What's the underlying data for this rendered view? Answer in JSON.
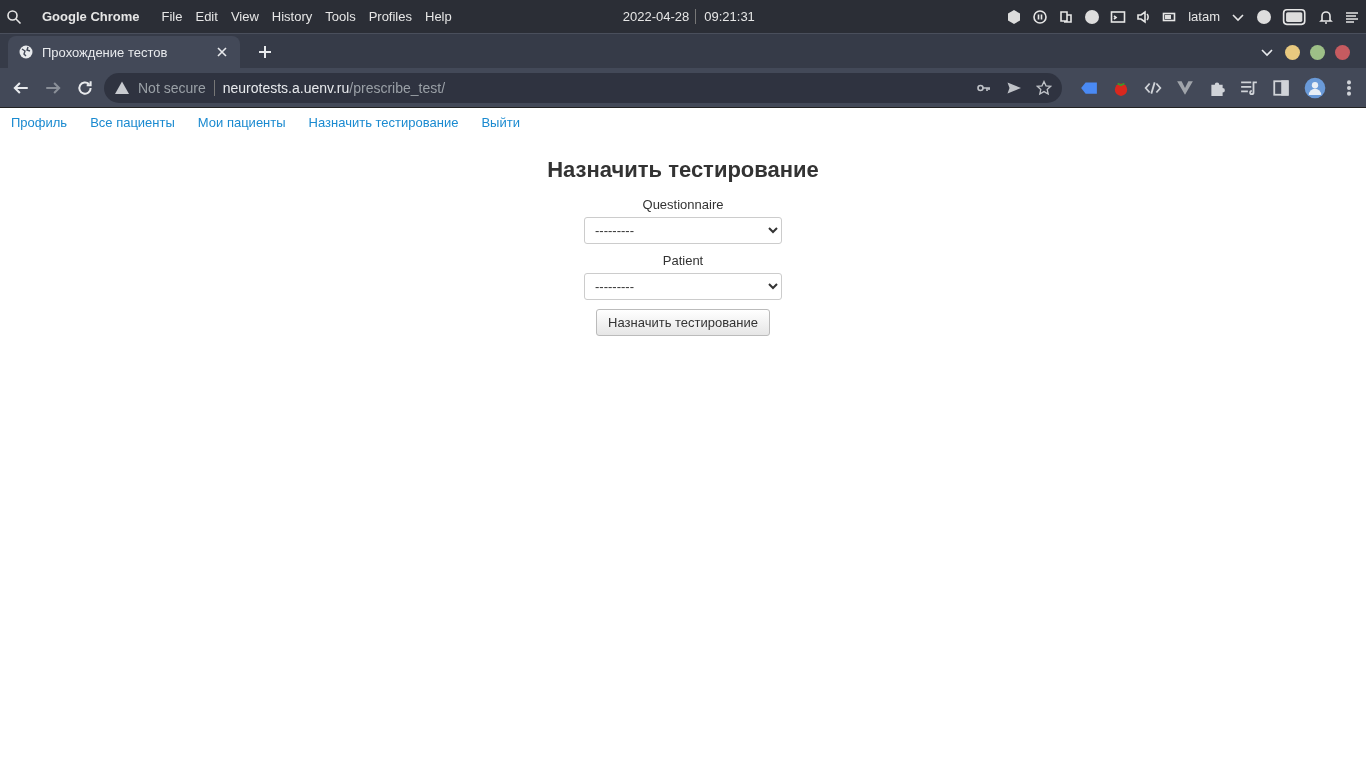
{
  "system_bar": {
    "app_name": "Google Chrome",
    "menus": [
      "File",
      "Edit",
      "View",
      "History",
      "Tools",
      "Profiles",
      "Help"
    ],
    "date": "2022-04-28",
    "time": "09:21:31",
    "keyboard_layout": "latam"
  },
  "browser": {
    "tab": {
      "title": "Прохождение тестов"
    },
    "security": "Not secure",
    "url_host": "neurotests.a.uenv.ru",
    "url_path": "/prescribe_test/"
  },
  "nav_links": [
    "Профиль",
    "Все пациенты",
    "Мои пациенты",
    "Назначить тестирование",
    "Выйти"
  ],
  "page": {
    "heading": "Назначить тестирование",
    "fields": [
      {
        "label": "Questionnaire",
        "value": "---------"
      },
      {
        "label": "Patient",
        "value": "---------"
      }
    ],
    "submit": "Назначить тестирование"
  }
}
